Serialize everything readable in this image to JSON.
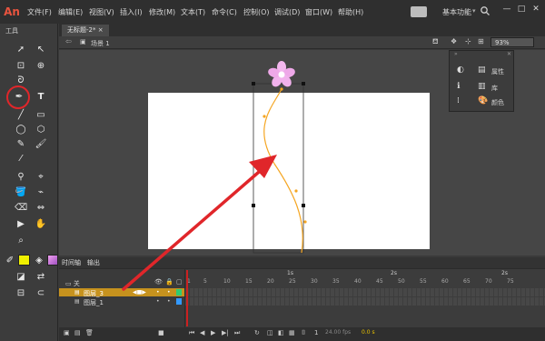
{
  "app": {
    "logo": "An"
  },
  "menu": [
    "文件(F)",
    "编辑(E)",
    "视图(V)",
    "插入(I)",
    "修改(M)",
    "文本(T)",
    "命令(C)",
    "控制(O)",
    "调试(D)",
    "窗口(W)",
    "帮助(H)"
  ],
  "workspace": {
    "label": "基本功能",
    "chevron": "▾"
  },
  "window_controls": [
    "—",
    "□",
    "✕"
  ],
  "tools": {
    "title": "工具"
  },
  "document": {
    "tab": "无标题-2*",
    "tab_close": "×",
    "scene": "场景 1",
    "zoom": "93%"
  },
  "panel": {
    "properties": "属性",
    "library": "库",
    "color": "颜色"
  },
  "timeline": {
    "tab_timeline": "时间轴",
    "tab_output": "输出",
    "layers": [
      "图层_3",
      "图层_1"
    ],
    "ruler": [
      "1",
      "5",
      "10",
      "15",
      "20",
      "25",
      "30",
      "35",
      "40",
      "45",
      "50",
      "55",
      "60",
      "65",
      "70",
      "75"
    ],
    "sec_1s": "1s",
    "sec_2s": "2s",
    "fps": "24.00 fps",
    "time": "0.0 s"
  },
  "annotation": {
    "color": "#e0262a"
  }
}
